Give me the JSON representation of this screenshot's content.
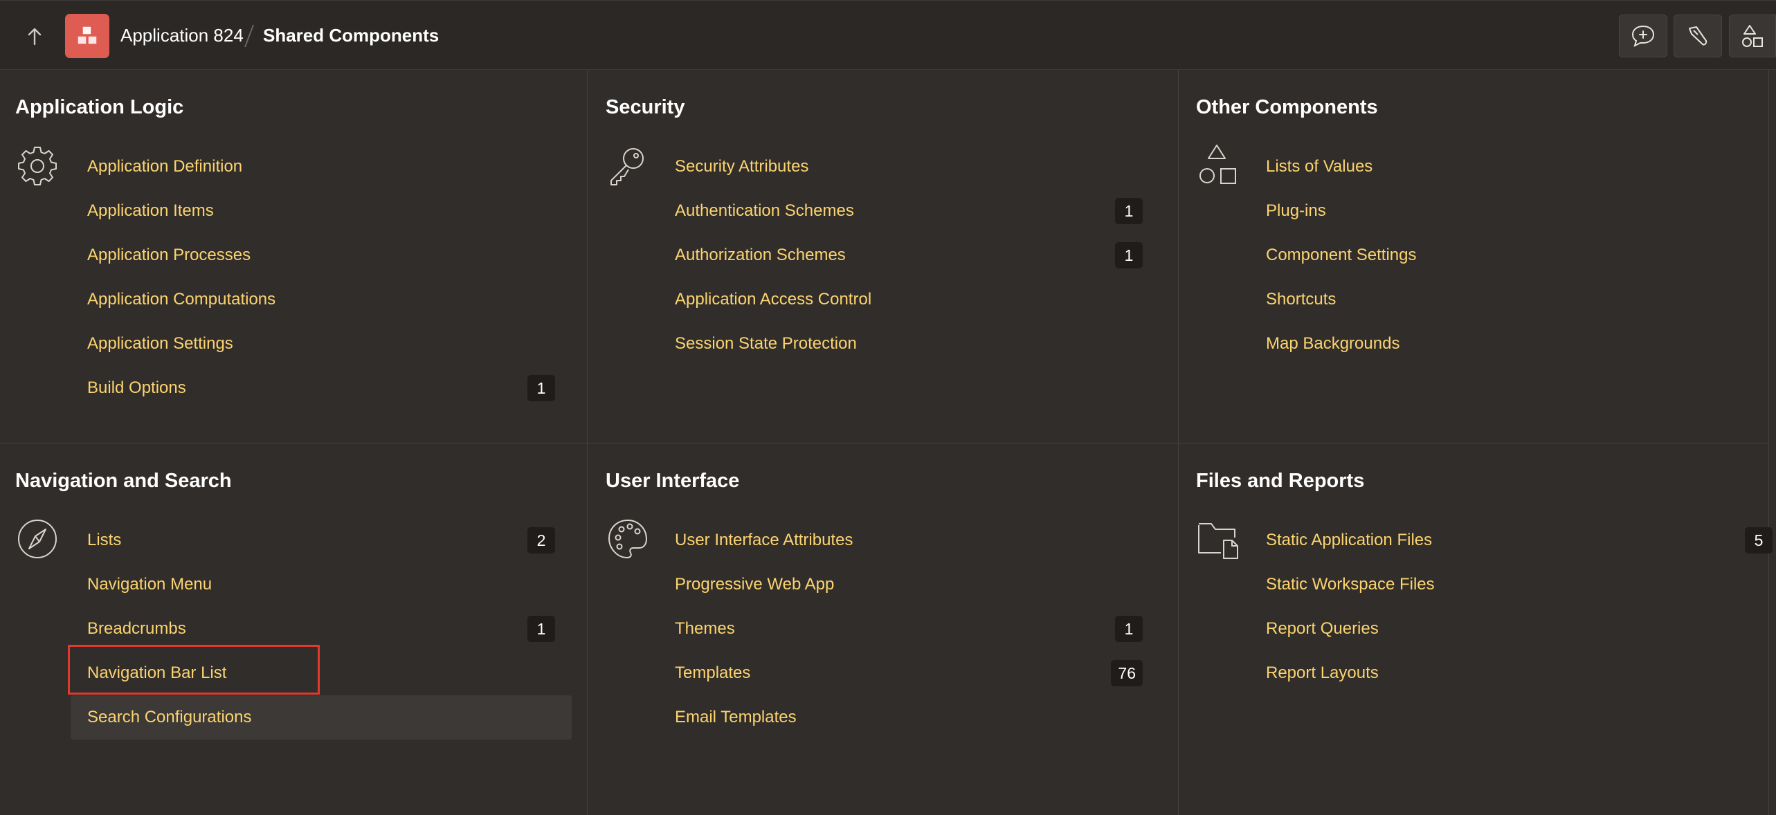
{
  "header": {
    "app_name": "Application 824",
    "current_page": "Shared Components",
    "buttons": [
      "up-arrow-icon",
      "app-icon",
      "feedback-icon",
      "developer-tools-icon",
      "shapes-icon"
    ]
  },
  "colors": {
    "background": "#312d2a",
    "header_background": "#2b2825",
    "link": "#fbd470",
    "app_icon": "#de5c52",
    "badge_background": "#1f1c1a",
    "highlight": "#e2392c"
  },
  "panels": [
    {
      "title": "Application Logic",
      "icon": "gear-icon",
      "items": [
        {
          "label": "Application Definition",
          "count": ""
        },
        {
          "label": "Application Items",
          "count": ""
        },
        {
          "label": "Application Processes",
          "count": ""
        },
        {
          "label": "Application Computations",
          "count": ""
        },
        {
          "label": "Application Settings",
          "count": ""
        },
        {
          "label": "Build Options",
          "count": "1"
        }
      ]
    },
    {
      "title": "Security",
      "icon": "key-icon",
      "items": [
        {
          "label": "Security Attributes",
          "count": ""
        },
        {
          "label": "Authentication Schemes",
          "count": "1"
        },
        {
          "label": "Authorization Schemes",
          "count": "1"
        },
        {
          "label": "Application Access Control",
          "count": ""
        },
        {
          "label": "Session State Protection",
          "count": ""
        }
      ]
    },
    {
      "title": "Other Components",
      "icon": "shapes-icon",
      "items": [
        {
          "label": "Lists of Values",
          "count": ""
        },
        {
          "label": "Plug-ins",
          "count": ""
        },
        {
          "label": "Component Settings",
          "count": ""
        },
        {
          "label": "Shortcuts",
          "count": ""
        },
        {
          "label": "Map Backgrounds",
          "count": ""
        }
      ]
    },
    {
      "title": "Navigation and Search",
      "icon": "compass-icon",
      "items": [
        {
          "label": "Lists",
          "count": "2"
        },
        {
          "label": "Navigation Menu",
          "count": ""
        },
        {
          "label": "Breadcrumbs",
          "count": "1"
        },
        {
          "label": "Navigation Bar List",
          "count": ""
        },
        {
          "label": "Search Configurations",
          "count": ""
        }
      ]
    },
    {
      "title": "User Interface",
      "icon": "palette-icon",
      "items": [
        {
          "label": "User Interface Attributes",
          "count": ""
        },
        {
          "label": "Progressive Web App",
          "count": ""
        },
        {
          "label": "Themes",
          "count": "1"
        },
        {
          "label": "Templates",
          "count": "76"
        },
        {
          "label": "Email Templates",
          "count": ""
        }
      ]
    },
    {
      "title": "Files and Reports",
      "icon": "folder-file-icon",
      "items": [
        {
          "label": "Static Application Files",
          "count": "5"
        },
        {
          "label": "Static Workspace Files",
          "count": ""
        },
        {
          "label": "Report Queries",
          "count": ""
        },
        {
          "label": "Report Layouts",
          "count": ""
        }
      ]
    }
  ]
}
